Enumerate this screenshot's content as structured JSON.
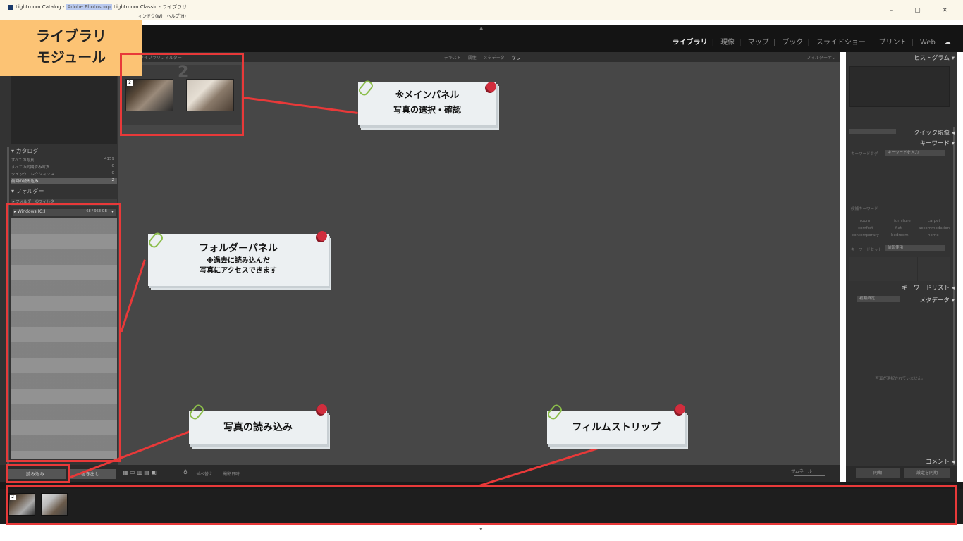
{
  "window": {
    "title_prefix": "Lightroom Catalog - ",
    "title_highlight": "Adobe Photoshop",
    "title_suffix": " Lightroom Classic - ライブラリ",
    "menu_partial": "ィンドウ(W)　ヘルプ(H)",
    "controls": "–  ▢  ✕"
  },
  "modules": [
    "ライブラリ",
    "現像",
    "マップ",
    "ブック",
    "スライドショー",
    "プリント",
    "Web"
  ],
  "active_module": "ライブラリ",
  "cloud_icon": "cloud-icon",
  "module_label": [
    "ライブラリ",
    "モジュール"
  ],
  "left_panel": {
    "catalog_header": "カタログ",
    "catalog_items": [
      {
        "label": "すべての写真",
        "count": "4159"
      },
      {
        "label": "すべての同期済み写真",
        "count": "0"
      },
      {
        "label": "クイックコレクション +",
        "count": "0"
      },
      {
        "label": "前回の読み込み",
        "count": "2"
      }
    ],
    "folders_header": "フォルダー",
    "folder_search": "フォルダーのフィルター",
    "volume": {
      "name": "Windows (C:)",
      "space": "68 / 953 GB"
    }
  },
  "left_toolbar": {
    "import": "読み込み...",
    "export": "書き出し..."
  },
  "filter_bar": {
    "label": "ライブラリフィルター：",
    "options": [
      "テキスト",
      "属性",
      "メタデータ",
      "なし"
    ],
    "filter_off": "フィルターオフ"
  },
  "grid": {
    "big_number": "2",
    "badge": "2"
  },
  "grid_toolbar": {
    "sort_label": "並べ替え：",
    "sort_value": "撮影日時",
    "thumb_label": "サムネール"
  },
  "right_panel": {
    "histogram": "ヒストグラム",
    "quick_develop": "クイック現像",
    "keywords": "キーワード",
    "keyword_tags_label": "キーワードタグ",
    "keyword_tags_value": "キーワードを入力",
    "suggestions_label": "候補キーワード",
    "suggestions": [
      "room",
      "furniture",
      "carpet",
      "comfort",
      "flat",
      "accommodation",
      "contemporary",
      "bedroom",
      "home"
    ],
    "keyword_set_label": "キーワードセット",
    "keyword_set_value": "前回使用",
    "keyword_list": "キーワードリスト",
    "metadata_preset": "初期設定",
    "metadata": "メタデータ",
    "no_photo": "写真が選択されていません。",
    "comments": "コメント",
    "sync": "同期",
    "sync_settings": "設定を同期"
  },
  "annotations": {
    "main_panel": {
      "line1": "※メインパネル",
      "line2": "写真の選択・確認"
    },
    "folder_panel": {
      "line1": "フォルダーパネル",
      "line2": "※過去に読み込んだ",
      "line3": "写真にアクセスできます"
    },
    "import": {
      "line1": "写真の読み込み"
    },
    "filmstrip": {
      "line1": "フィルムストリップ"
    }
  },
  "colors": {
    "annotation_red": "#e83939",
    "module_label_bg": "#fcc374",
    "note_bg": "#ecf0f2",
    "pin": "#d12d3d",
    "clip": "#8bbd4a"
  }
}
